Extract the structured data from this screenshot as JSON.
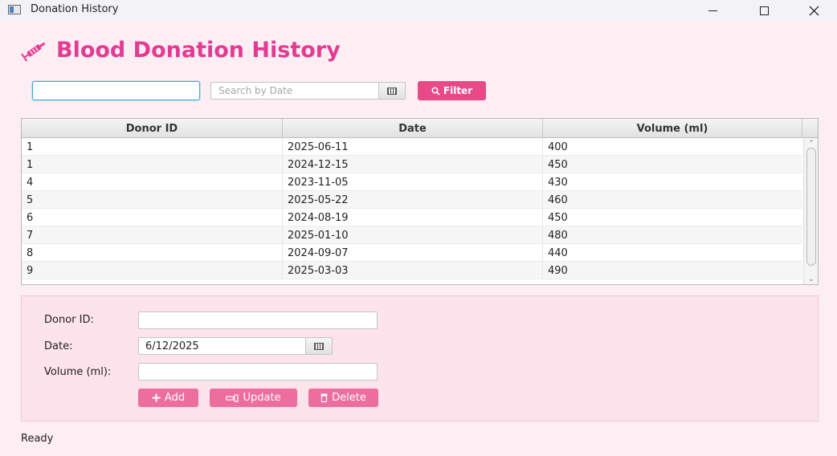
{
  "window": {
    "title": "Donation History"
  },
  "page": {
    "title": "Blood Donation History",
    "title_color": "#e33b93",
    "icon": "syringe-icon"
  },
  "toolbar": {
    "search_value": "",
    "date_search_placeholder": "Search by Date",
    "filter_label": "Filter",
    "filter_icon": "magnifier-icon",
    "accent_color": "#e84a87"
  },
  "table": {
    "columns": [
      "Donor ID",
      "Date",
      "Volume (ml)"
    ],
    "rows": [
      {
        "donor_id": "1",
        "date": "2025-06-11",
        "volume": "400"
      },
      {
        "donor_id": "1",
        "date": "2024-12-15",
        "volume": "450"
      },
      {
        "donor_id": "4",
        "date": "2023-11-05",
        "volume": "430"
      },
      {
        "donor_id": "5",
        "date": "2025-05-22",
        "volume": "460"
      },
      {
        "donor_id": "6",
        "date": "2024-08-19",
        "volume": "450"
      },
      {
        "donor_id": "7",
        "date": "2025-01-10",
        "volume": "480"
      },
      {
        "donor_id": "8",
        "date": "2024-09-07",
        "volume": "440"
      },
      {
        "donor_id": "9",
        "date": "2025-03-03",
        "volume": "490"
      }
    ]
  },
  "form": {
    "donor_id_label": "Donor ID:",
    "donor_id_value": "",
    "date_label": "Date:",
    "date_value": "6/12/2025",
    "volume_label": "Volume (ml):",
    "volume_value": "",
    "add_label": "Add",
    "update_label": "Update",
    "delete_label": "Delete",
    "add_icon": "plus-icon",
    "update_icon": "pencil-icon",
    "delete_icon": "trash-icon",
    "button_color": "#ee6d9f"
  },
  "status": {
    "text": "Ready"
  }
}
